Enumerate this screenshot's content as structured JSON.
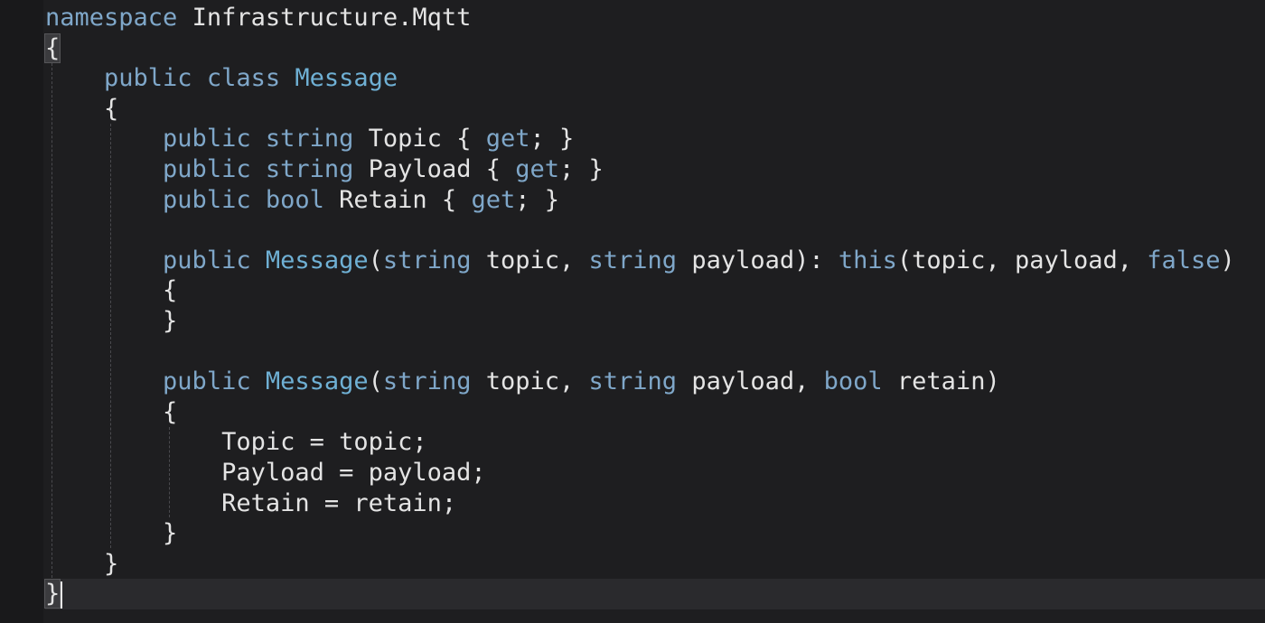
{
  "editor": {
    "language": "C#",
    "theme_colors": {
      "background": "#1e1e20",
      "keyword": "#7fa7c9",
      "type": "#6fb0d4",
      "identifier": "#e4e4e4",
      "guide": "#4a4a4e"
    },
    "lines": [
      {
        "tokens": [
          {
            "t": "namespace",
            "c": "kw"
          },
          {
            "t": " Infrastructure.Mqtt",
            "c": "id"
          }
        ]
      },
      {
        "tokens": [
          {
            "t": "{",
            "c": "brace-hl"
          }
        ]
      },
      {
        "tokens": [
          {
            "t": "    "
          },
          {
            "t": "public",
            "c": "kw"
          },
          {
            "t": " "
          },
          {
            "t": "class",
            "c": "kw"
          },
          {
            "t": " "
          },
          {
            "t": "Message",
            "c": "ty"
          }
        ]
      },
      {
        "tokens": [
          {
            "t": "    {"
          }
        ]
      },
      {
        "tokens": [
          {
            "t": "        "
          },
          {
            "t": "public",
            "c": "kw"
          },
          {
            "t": " "
          },
          {
            "t": "string",
            "c": "kw"
          },
          {
            "t": " Topic { "
          },
          {
            "t": "get",
            "c": "kw"
          },
          {
            "t": "; }"
          }
        ]
      },
      {
        "tokens": [
          {
            "t": "        "
          },
          {
            "t": "public",
            "c": "kw"
          },
          {
            "t": " "
          },
          {
            "t": "string",
            "c": "kw"
          },
          {
            "t": " Payload { "
          },
          {
            "t": "get",
            "c": "kw"
          },
          {
            "t": "; }"
          }
        ]
      },
      {
        "tokens": [
          {
            "t": "        "
          },
          {
            "t": "public",
            "c": "kw"
          },
          {
            "t": " "
          },
          {
            "t": "bool",
            "c": "kw"
          },
          {
            "t": " Retain { "
          },
          {
            "t": "get",
            "c": "kw"
          },
          {
            "t": "; }"
          }
        ]
      },
      {
        "tokens": [
          {
            "t": ""
          }
        ]
      },
      {
        "tokens": [
          {
            "t": "        "
          },
          {
            "t": "public",
            "c": "kw"
          },
          {
            "t": " "
          },
          {
            "t": "Message",
            "c": "ty"
          },
          {
            "t": "("
          },
          {
            "t": "string",
            "c": "kw"
          },
          {
            "t": " topic, "
          },
          {
            "t": "string",
            "c": "kw"
          },
          {
            "t": " payload): "
          },
          {
            "t": "this",
            "c": "kw"
          },
          {
            "t": "(topic, payload, "
          },
          {
            "t": "false",
            "c": "kw"
          },
          {
            "t": ")"
          }
        ]
      },
      {
        "tokens": [
          {
            "t": "        {"
          }
        ]
      },
      {
        "tokens": [
          {
            "t": "        }"
          }
        ]
      },
      {
        "tokens": [
          {
            "t": ""
          }
        ]
      },
      {
        "tokens": [
          {
            "t": "        "
          },
          {
            "t": "public",
            "c": "kw"
          },
          {
            "t": " "
          },
          {
            "t": "Message",
            "c": "ty"
          },
          {
            "t": "("
          },
          {
            "t": "string",
            "c": "kw"
          },
          {
            "t": " topic, "
          },
          {
            "t": "string",
            "c": "kw"
          },
          {
            "t": " payload, "
          },
          {
            "t": "bool",
            "c": "kw"
          },
          {
            "t": " retain)"
          }
        ]
      },
      {
        "tokens": [
          {
            "t": "        {"
          }
        ]
      },
      {
        "tokens": [
          {
            "t": "            Topic = topic;"
          }
        ]
      },
      {
        "tokens": [
          {
            "t": "            Payload = payload;"
          }
        ]
      },
      {
        "tokens": [
          {
            "t": "            Retain = retain;"
          }
        ]
      },
      {
        "tokens": [
          {
            "t": "        }"
          }
        ]
      },
      {
        "tokens": [
          {
            "t": "    }"
          }
        ]
      },
      {
        "tokens": [
          {
            "t": "}",
            "c": "brace-hl"
          }
        ],
        "current": true,
        "caret": true
      }
    ]
  }
}
